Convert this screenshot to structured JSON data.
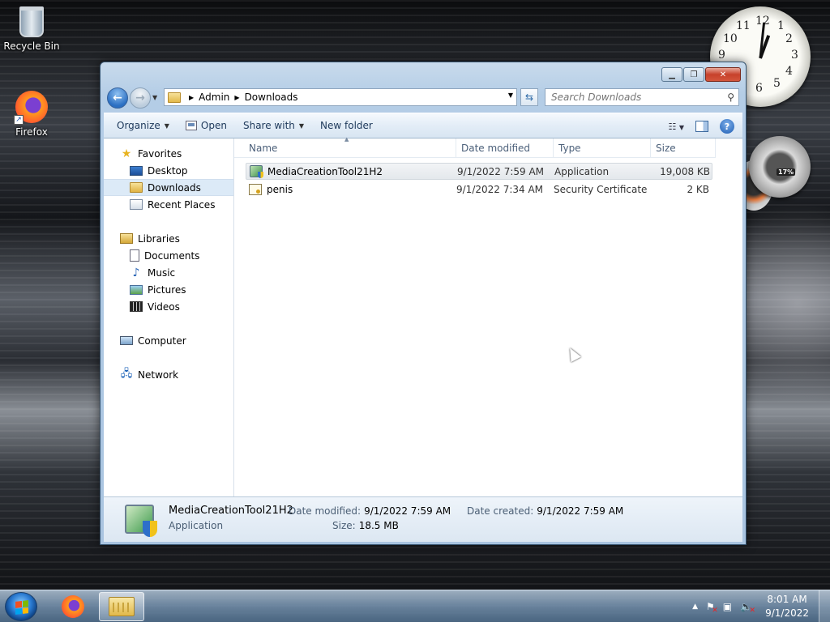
{
  "desktop": {
    "icons": [
      {
        "label": "Recycle Bin",
        "icon": "recycle-bin-icon"
      },
      {
        "label": "Firefox",
        "icon": "firefox-icon"
      }
    ],
    "gadgets": {
      "clock_numbers": [
        "12",
        "1",
        "2",
        "3",
        "4",
        "5",
        "6",
        "9",
        "10",
        "11"
      ],
      "meter_percent_label": "17%"
    }
  },
  "window": {
    "address": {
      "segments": [
        "Admin",
        "Downloads"
      ]
    },
    "search": {
      "placeholder": "Search Downloads"
    },
    "toolbar": {
      "organize": "Organize",
      "open": "Open",
      "share_with": "Share with",
      "new_folder": "New folder"
    },
    "nav_pane": {
      "favorites": {
        "label": "Favorites",
        "items": [
          "Desktop",
          "Downloads",
          "Recent Places"
        ]
      },
      "libraries": {
        "label": "Libraries",
        "items": [
          "Documents",
          "Music",
          "Pictures",
          "Videos"
        ]
      },
      "computer": "Computer",
      "network": "Network",
      "selected": "Downloads"
    },
    "columns": {
      "name": "Name",
      "date": "Date modified",
      "type": "Type",
      "size": "Size"
    },
    "files": [
      {
        "name": "MediaCreationTool21H2",
        "date": "9/1/2022 7:59 AM",
        "type": "Application",
        "size": "19,008 KB",
        "selected": true
      },
      {
        "name": "penis",
        "date": "9/1/2022 7:34 AM",
        "type": "Security Certificate",
        "size": "2 KB",
        "selected": false
      }
    ],
    "details": {
      "name": "MediaCreationTool21H2",
      "type": "Application",
      "date_modified_label": "Date modified:",
      "date_modified": "9/1/2022 7:59 AM",
      "size_label": "Size:",
      "size": "18.5 MB",
      "date_created_label": "Date created:",
      "date_created": "9/1/2022 7:59 AM"
    }
  },
  "taskbar": {
    "time": "8:01 AM",
    "date": "9/1/2022"
  },
  "colors": {
    "selection_bg": "#dceaf7",
    "toolbar_text": "#1e395b",
    "start_orb": "#2a7ad1"
  }
}
